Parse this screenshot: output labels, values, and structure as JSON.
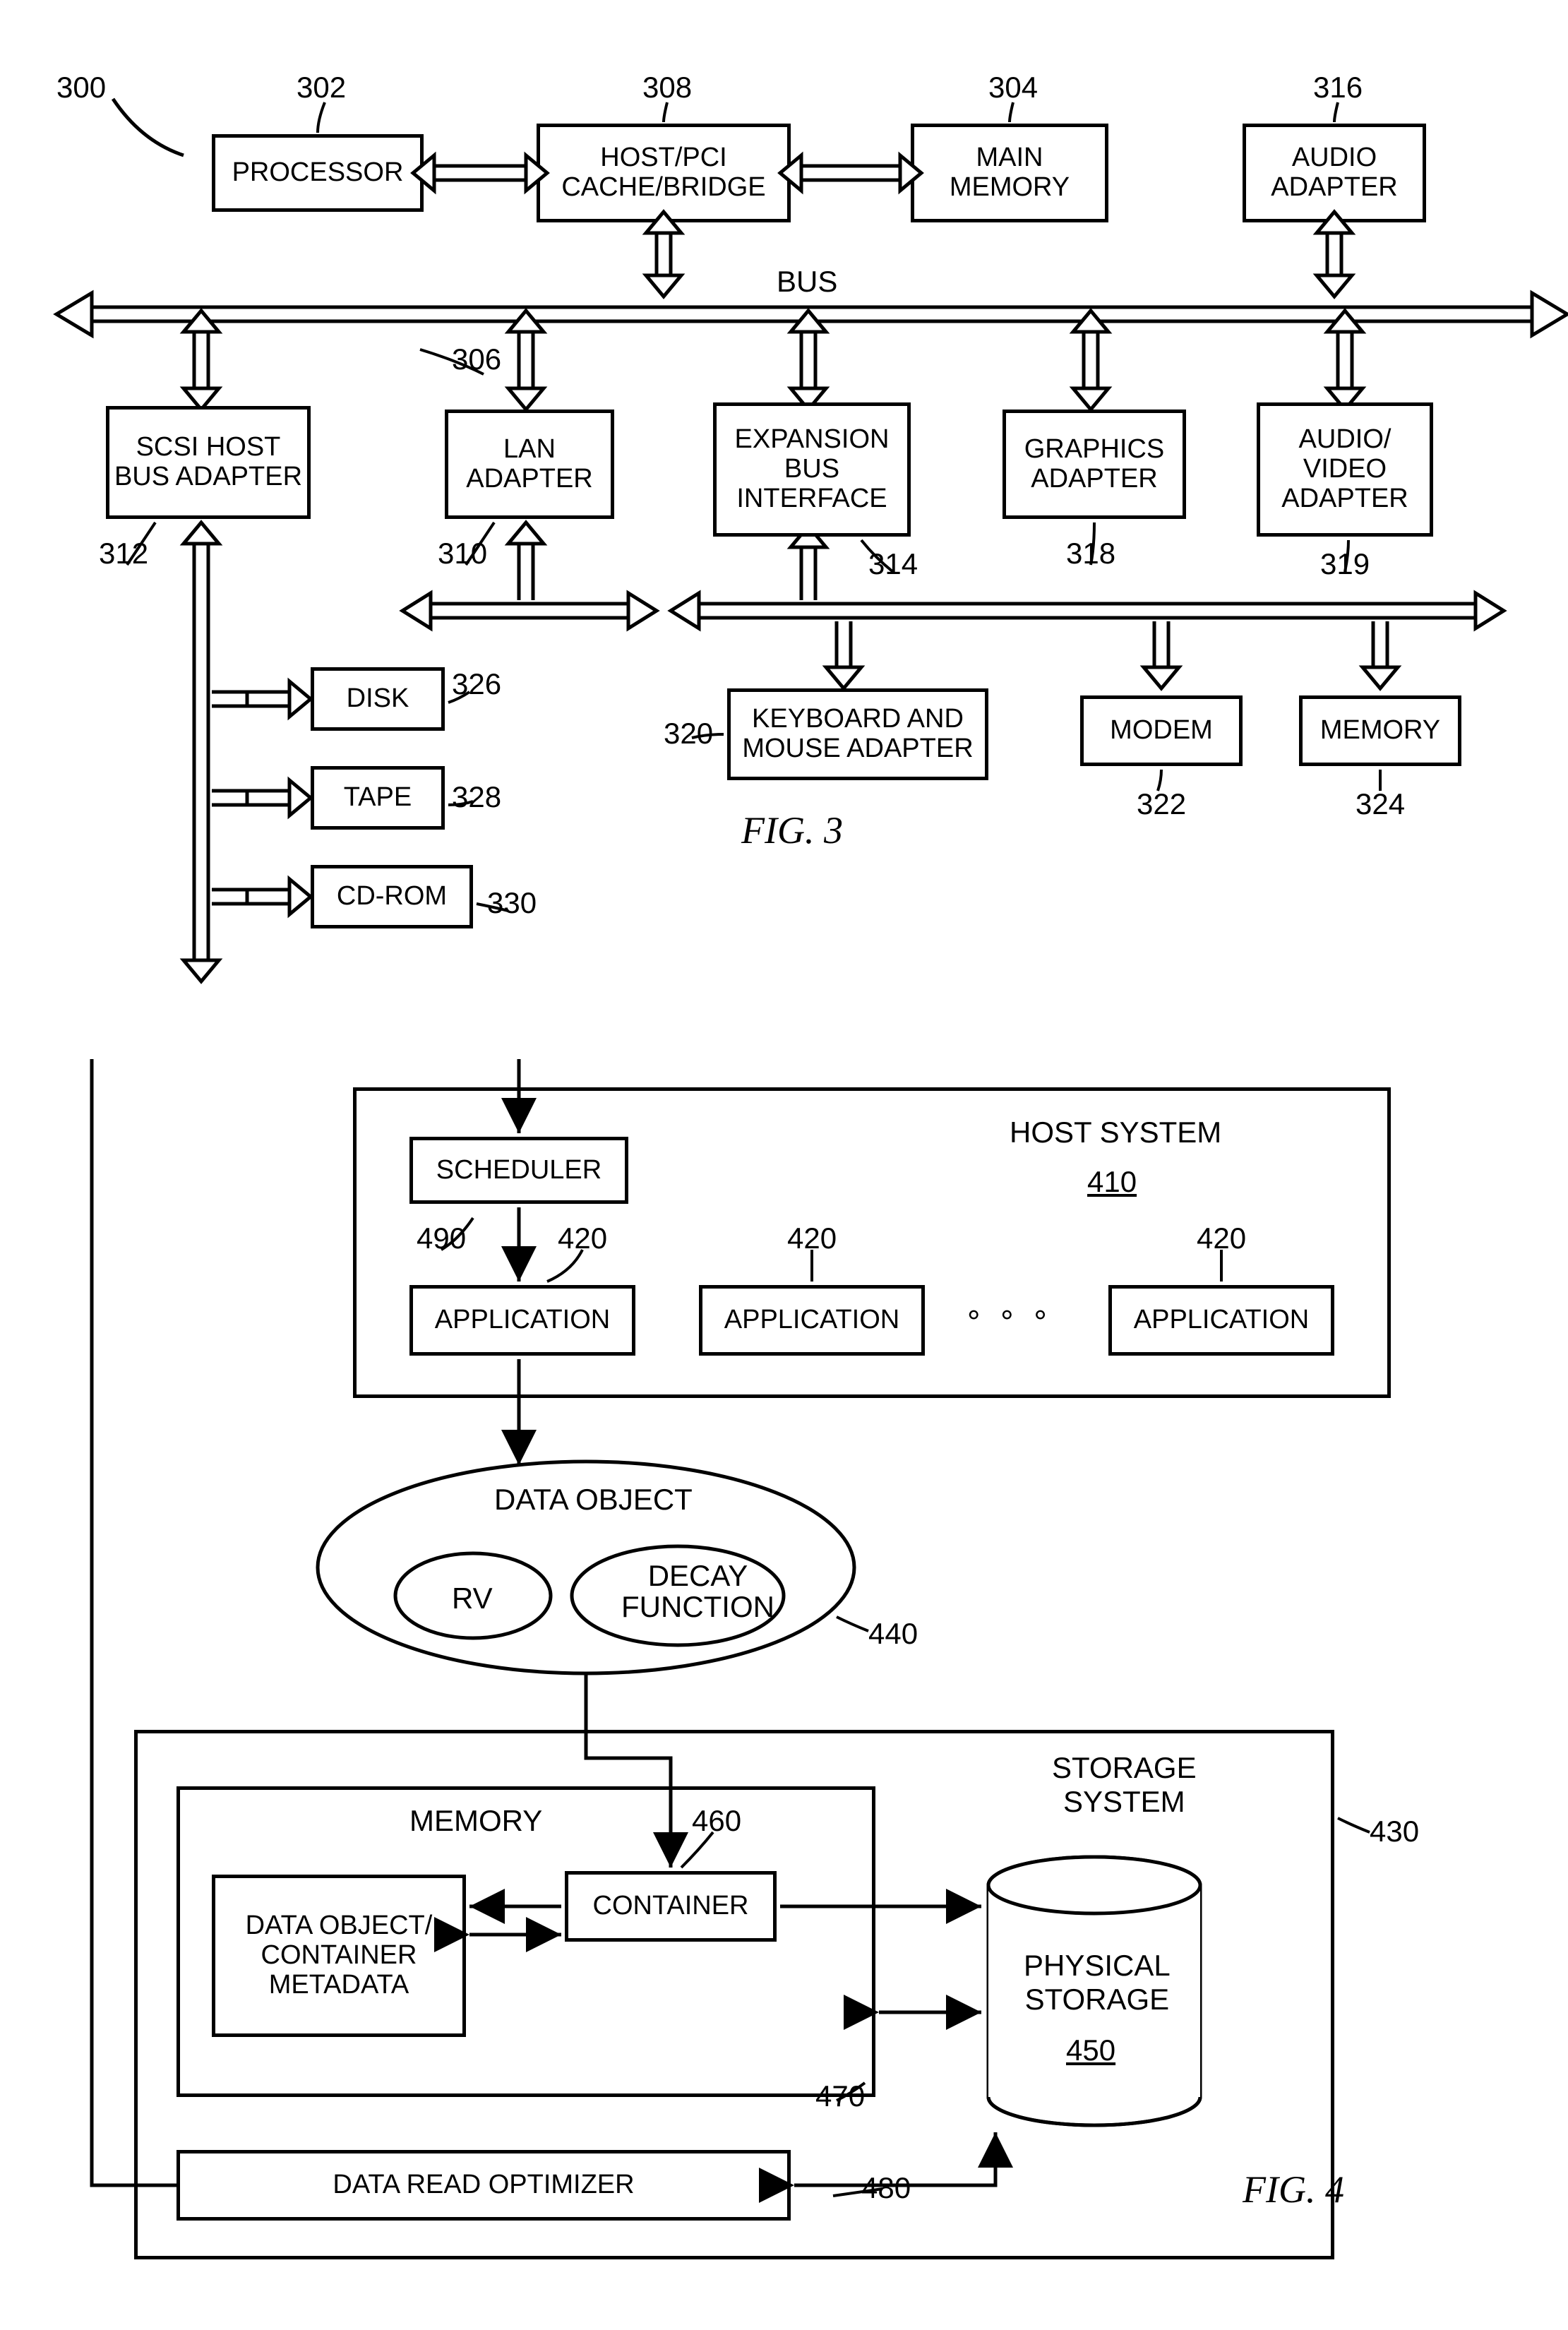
{
  "fig3": {
    "ref_main": "300",
    "bus_label": "BUS",
    "caption": "FIG. 3",
    "blocks": {
      "processor": {
        "label": "PROCESSOR",
        "ref": "302"
      },
      "host_bridge": {
        "label": "HOST/PCI\nCACHE/BRIDGE",
        "ref": "308"
      },
      "main_memory": {
        "label": "MAIN\nMEMORY",
        "ref": "304"
      },
      "audio_adapter": {
        "label": "AUDIO\nADAPTER",
        "ref": "316"
      },
      "scsi": {
        "label": "SCSI HOST\nBUS ADAPTER",
        "ref": "312"
      },
      "lan": {
        "label": "LAN\nADAPTER",
        "ref": "310"
      },
      "expbus": {
        "label": "EXPANSION\nBUS\nINTERFACE",
        "ref": "314"
      },
      "graphics": {
        "label": "GRAPHICS\nADAPTER",
        "ref": "318"
      },
      "av": {
        "label": "AUDIO/\nVIDEO\nADAPTER",
        "ref": "319"
      },
      "disk": {
        "label": "DISK",
        "ref": "326"
      },
      "tape": {
        "label": "TAPE",
        "ref": "328"
      },
      "cdrom": {
        "label": "CD-ROM",
        "ref": "330"
      },
      "kbm": {
        "label": "KEYBOARD AND\nMOUSE ADAPTER",
        "ref": "320"
      },
      "modem": {
        "label": "MODEM",
        "ref": "322"
      },
      "memory": {
        "label": "MEMORY",
        "ref": "324"
      },
      "bus_ref": "306"
    }
  },
  "fig4": {
    "caption": "FIG. 4",
    "host_system": {
      "label": "HOST SYSTEM",
      "ref": "410"
    },
    "scheduler": {
      "label": "SCHEDULER",
      "ref": "490"
    },
    "applications": {
      "label": "APPLICATION",
      "ref": "420"
    },
    "ellipsis": "°  °  °",
    "data_object": {
      "label": "DATA OBJECT",
      "ref": "440"
    },
    "rv": "RV",
    "decay": "DECAY\nFUNCTION",
    "storage_system": {
      "label": "STORAGE\nSYSTEM",
      "ref": "430"
    },
    "memory": {
      "label": "MEMORY"
    },
    "container": {
      "label": "CONTAINER",
      "ref": "460"
    },
    "metadata": {
      "label": "DATA OBJECT/\nCONTAINER\nMETADATA",
      "ref": "470"
    },
    "phys_storage": {
      "label": "PHYSICAL\nSTORAGE",
      "ref": "450"
    },
    "optimizer": {
      "label": "DATA READ OPTIMIZER",
      "ref": "480"
    }
  }
}
